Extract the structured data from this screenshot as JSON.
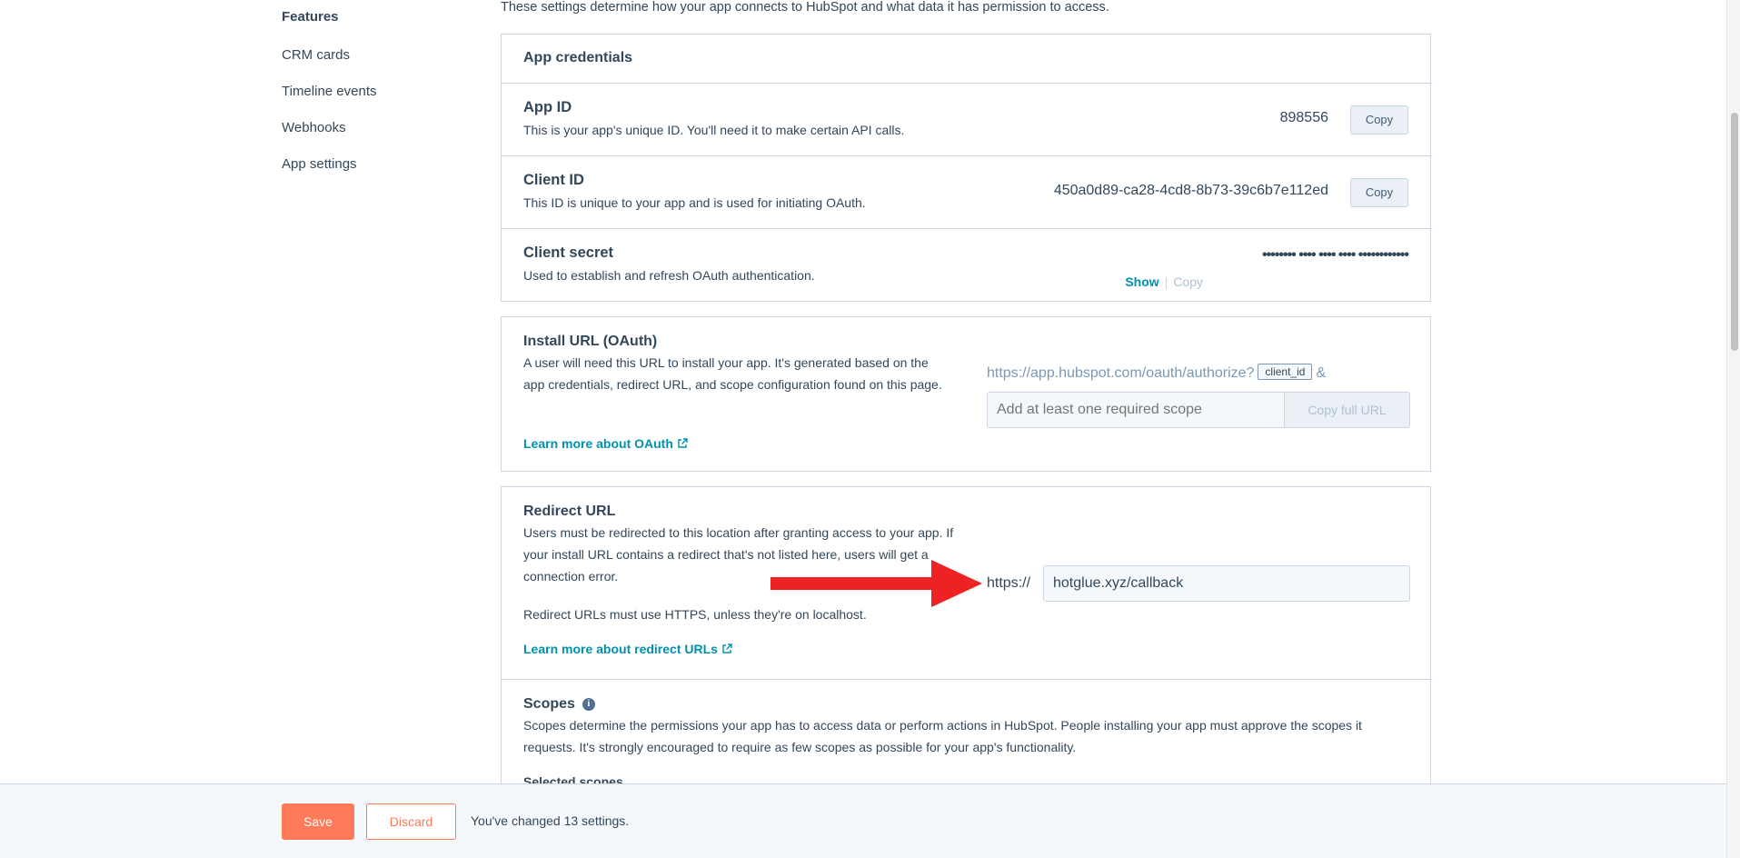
{
  "sidebar": {
    "heading": "Features",
    "items": [
      {
        "label": "CRM cards"
      },
      {
        "label": "Timeline events"
      },
      {
        "label": "Webhooks"
      },
      {
        "label": "App settings"
      }
    ]
  },
  "intro": "These settings determine how your app connects to HubSpot and what data it has permission to access.",
  "credentials": {
    "header": "App credentials",
    "app_id": {
      "title": "App ID",
      "desc": "This is your app's unique ID. You'll need it to make certain API calls.",
      "value": "898556",
      "copy_label": "Copy"
    },
    "client_id": {
      "title": "Client ID",
      "desc": "This ID is unique to your app and is used for initiating OAuth.",
      "value": "450a0d89-ca28-4cd8-8b73-39c6b7e112ed",
      "copy_label": "Copy"
    },
    "client_secret": {
      "title": "Client secret",
      "desc": "Used to establish and refresh OAuth authentication.",
      "masked": "•••••••• •••• •••• •••• ••••••••••••",
      "show_label": "Show",
      "separator": "|",
      "copy_label": "Copy"
    }
  },
  "install_url": {
    "title": "Install URL (OAuth)",
    "desc": "A user will need this URL to install your app. It's generated based on the app credentials, redirect URL, and scope configuration found on this page.",
    "link": "Learn more about OAuth",
    "base_url": "https://app.hubspot.com/oauth/authorize?",
    "token": "client_id",
    "amp": "&",
    "scope_placeholder": "Add at least one required scope",
    "copy_full_url": "Copy full URL"
  },
  "redirect": {
    "title": "Redirect URL",
    "desc": "Users must be redirected to this location after granting access to your app. If your install URL contains a redirect that's not listed here, users will get a connection error.",
    "note": "Redirect URLs must use HTTPS, unless they're on localhost.",
    "link": "Learn more about redirect URLs",
    "prefix": "https://",
    "value": "hotglue.xyz/callback"
  },
  "scopes": {
    "title": "Scopes",
    "info_glyph": "i",
    "desc": "Scopes determine the permissions your app has to access data or perform actions in HubSpot. People installing your app must approve the scopes it requests. It's strongly encouraged to require as few scopes as possible for your app's functionality.",
    "selected_heading": "Selected scopes"
  },
  "footer": {
    "save_label": "Save",
    "discard_label": "Discard",
    "changed_text": "You've changed 13 settings."
  },
  "colors": {
    "accent": "#0091ae",
    "primary_button": "#ff7a59",
    "arrow": "#ee2222",
    "text": "#33475b",
    "border": "#cbd6e2"
  },
  "icons": {
    "external_link": "external-link-icon",
    "info": "info-icon",
    "annotation_arrow": "red-arrow"
  }
}
